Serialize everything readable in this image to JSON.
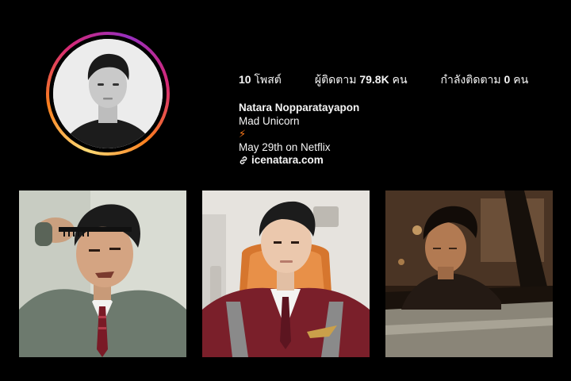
{
  "profile": {
    "posts_count": "10",
    "posts_label": "โพสต์",
    "followers_label": "ผู้ติดตาม",
    "followers_count": "79.8K",
    "followers_unit": "คน",
    "following_label": "กำลังติดตาม",
    "following_count": "0",
    "following_unit": "คน"
  },
  "bio": {
    "name": "Natara Nopparatayapon",
    "line1": "Mad Unicorn",
    "emoji": "⚡",
    "line2": "May 29th on Netflix",
    "link": "icenatara.com"
  },
  "grid": {
    "posts": [
      {
        "icon": "post-photo-school-uniform"
      },
      {
        "icon": "post-photo-pilot-uniform"
      },
      {
        "icon": "post-photo-car-night"
      }
    ]
  },
  "colors": {
    "background": "#000000",
    "text": "#f5f5f5",
    "accent_bolt": "#ff7a1a"
  }
}
